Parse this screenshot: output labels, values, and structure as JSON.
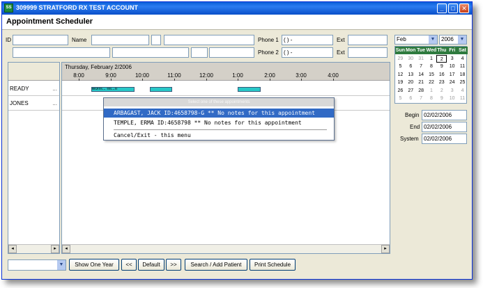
{
  "window": {
    "title": "309999 STRATFORD RX TEST ACCOUNT",
    "icon_label": "SS",
    "minimize": "_",
    "maximize": "□",
    "close": "✕"
  },
  "header": {
    "title": "Appointment Scheduler"
  },
  "patient_form": {
    "id_label": "ID",
    "name_label": "Name",
    "phone1_label": "Phone 1",
    "phone1_value": "(  )    -",
    "phone2_label": "Phone 2",
    "phone2_value": "(  )    -",
    "ext1_label": "Ext",
    "ext2_label": "Ext"
  },
  "schedule": {
    "date_heading": "Thursday, February 2/2006",
    "times": [
      "8:00",
      "9:00",
      "10:00",
      "11:00",
      "12:00",
      "1:00",
      "2:00",
      "3:00",
      "4:00"
    ],
    "resources": [
      {
        "name": "READY",
        "more": "..."
      },
      {
        "name": "JONES",
        "more": "..."
      }
    ],
    "appt_text": "worm... mi...n"
  },
  "popup": {
    "heading": "Select one of these appointments",
    "items": [
      "ARBAGAST, JACK  ID:4658798-G ** No notes for this appointment",
      "TEMPLE, ERMA  ID:4658798 ** No notes for this appointment",
      "Cancel/Exit - this menu"
    ]
  },
  "calendar": {
    "month": "Feb",
    "year": "2006",
    "weekdays": [
      "Sun",
      "Mon",
      "Tue",
      "Wed",
      "Thu",
      "Fri",
      "Sat"
    ],
    "rows": [
      [
        "29",
        "30",
        "31",
        "1",
        "2",
        "3",
        "4"
      ],
      [
        "5",
        "6",
        "7",
        "8",
        "9",
        "10",
        "11"
      ],
      [
        "12",
        "13",
        "14",
        "15",
        "16",
        "17",
        "18"
      ],
      [
        "19",
        "20",
        "21",
        "22",
        "23",
        "24",
        "25"
      ],
      [
        "26",
        "27",
        "28",
        "1",
        "2",
        "3",
        "4"
      ],
      [
        "5",
        "6",
        "7",
        "8",
        "9",
        "10",
        "11"
      ]
    ],
    "header_color": "#2e7a3e"
  },
  "dates": {
    "begin_label": "Begin",
    "begin_value": "02/02/2006",
    "end_label": "End",
    "end_value": "02/02/2006",
    "system_label": "System",
    "system_value": "02/02/2006"
  },
  "toolbar": {
    "show_one_year": "Show One Year",
    "prev": "<<",
    "default": "Default",
    "next": ">>",
    "search_add": "Search / Add Patient",
    "print": "Print Schedule"
  },
  "colors": {
    "accent": "#316ac5",
    "appointment": "#28c8c8"
  }
}
